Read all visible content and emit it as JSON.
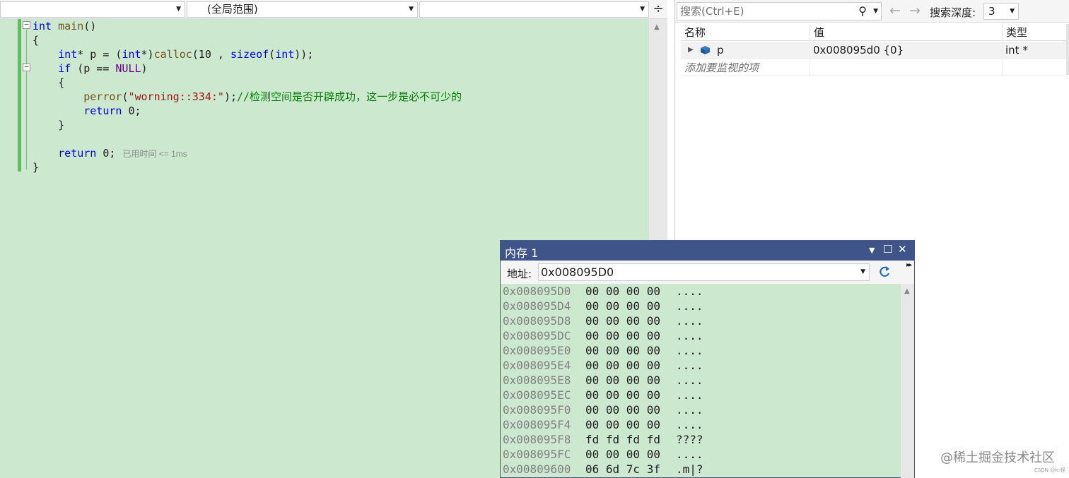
{
  "nav_bar": {
    "project": "",
    "scope": "(全局范围)",
    "member": ""
  },
  "code": {
    "lines": [
      {
        "tokens": [
          {
            "t": "int",
            "c": "kw"
          },
          {
            "t": " "
          },
          {
            "t": "main",
            "c": "fn"
          },
          {
            "t": "()"
          }
        ]
      },
      {
        "tokens": [
          {
            "t": "{"
          }
        ]
      },
      {
        "tokens": [
          {
            "t": "    "
          },
          {
            "t": "int",
            "c": "kw"
          },
          {
            "t": "* p = ("
          },
          {
            "t": "int",
            "c": "kw"
          },
          {
            "t": "*)"
          },
          {
            "t": "calloc",
            "c": "fn"
          },
          {
            "t": "(10 , "
          },
          {
            "t": "sizeof",
            "c": "kw"
          },
          {
            "t": "("
          },
          {
            "t": "int",
            "c": "kw"
          },
          {
            "t": "));"
          }
        ]
      },
      {
        "tokens": [
          {
            "t": "    "
          },
          {
            "t": "if",
            "c": "kw"
          },
          {
            "t": " (p == "
          },
          {
            "t": "NULL",
            "c": "mac"
          },
          {
            "t": ")"
          }
        ]
      },
      {
        "tokens": [
          {
            "t": "    {"
          }
        ]
      },
      {
        "tokens": [
          {
            "t": "        "
          },
          {
            "t": "perror",
            "c": "fn"
          },
          {
            "t": "("
          },
          {
            "t": "\"worning::334:\"",
            "c": "str"
          },
          {
            "t": ");"
          },
          {
            "t": "//检测空间是否开辟成功，这一步是必不可少的",
            "c": "cmt"
          }
        ]
      },
      {
        "tokens": [
          {
            "t": "        "
          },
          {
            "t": "return",
            "c": "kw"
          },
          {
            "t": " 0;"
          }
        ]
      },
      {
        "tokens": [
          {
            "t": "    }"
          }
        ]
      },
      {
        "tokens": []
      },
      {
        "tokens": [
          {
            "t": "    "
          },
          {
            "t": "return",
            "c": "kw"
          },
          {
            "t": " 0;"
          }
        ]
      },
      {
        "tokens": [
          {
            "t": "}"
          }
        ]
      }
    ],
    "perf_tip": "已用时间 <= 1ms"
  },
  "watch": {
    "search_placeholder": "搜索(Ctrl+E)",
    "search_depth_label": "搜索深度:",
    "search_depth_value": "3",
    "columns": {
      "name": "名称",
      "value": "值",
      "type": "类型"
    },
    "rows": [
      {
        "name": "p",
        "value": "0x008095d0 {0}",
        "type": "int *"
      }
    ],
    "add_item_hint": "添加要监视的项"
  },
  "memory": {
    "title": "内存 1",
    "address_label": "地址:",
    "address_value": "0x008095D0",
    "rows": [
      {
        "addr": "0x008095D0",
        "bytes": "00 00 00 00",
        "ascii": "...."
      },
      {
        "addr": "0x008095D4",
        "bytes": "00 00 00 00",
        "ascii": "...."
      },
      {
        "addr": "0x008095D8",
        "bytes": "00 00 00 00",
        "ascii": "...."
      },
      {
        "addr": "0x008095DC",
        "bytes": "00 00 00 00",
        "ascii": "...."
      },
      {
        "addr": "0x008095E0",
        "bytes": "00 00 00 00",
        "ascii": "...."
      },
      {
        "addr": "0x008095E4",
        "bytes": "00 00 00 00",
        "ascii": "...."
      },
      {
        "addr": "0x008095E8",
        "bytes": "00 00 00 00",
        "ascii": "...."
      },
      {
        "addr": "0x008095EC",
        "bytes": "00 00 00 00",
        "ascii": "...."
      },
      {
        "addr": "0x008095F0",
        "bytes": "00 00 00 00",
        "ascii": "...."
      },
      {
        "addr": "0x008095F4",
        "bytes": "00 00 00 00",
        "ascii": "...."
      },
      {
        "addr": "0x008095F8",
        "bytes": "fd fd fd fd",
        "ascii": "????"
      },
      {
        "addr": "0x008095FC",
        "bytes": "00 00 00 00",
        "ascii": "...."
      },
      {
        "addr": "0x00809600",
        "bytes": "06 6d 7c 3f",
        "ascii": ".m|?"
      }
    ]
  },
  "watermark": {
    "text": "@稀土掘金技术社区",
    "small": "CSDN @Ici怪"
  },
  "colors": {
    "editor_bg": "#cce8cf",
    "memory_title_bg": "#3f5589",
    "keyword": "#0000ff",
    "function": "#74531f",
    "string": "#a31515",
    "comment": "#008000",
    "change_bar": "#57c257"
  },
  "icons": {
    "split": "split-editor-icon",
    "search": "search-icon",
    "back": "back-arrow-icon",
    "forward": "forward-arrow-icon",
    "variable": "variable-cube-icon",
    "refresh": "refresh-icon",
    "close": "close-icon",
    "maximize": "maximize-icon"
  }
}
